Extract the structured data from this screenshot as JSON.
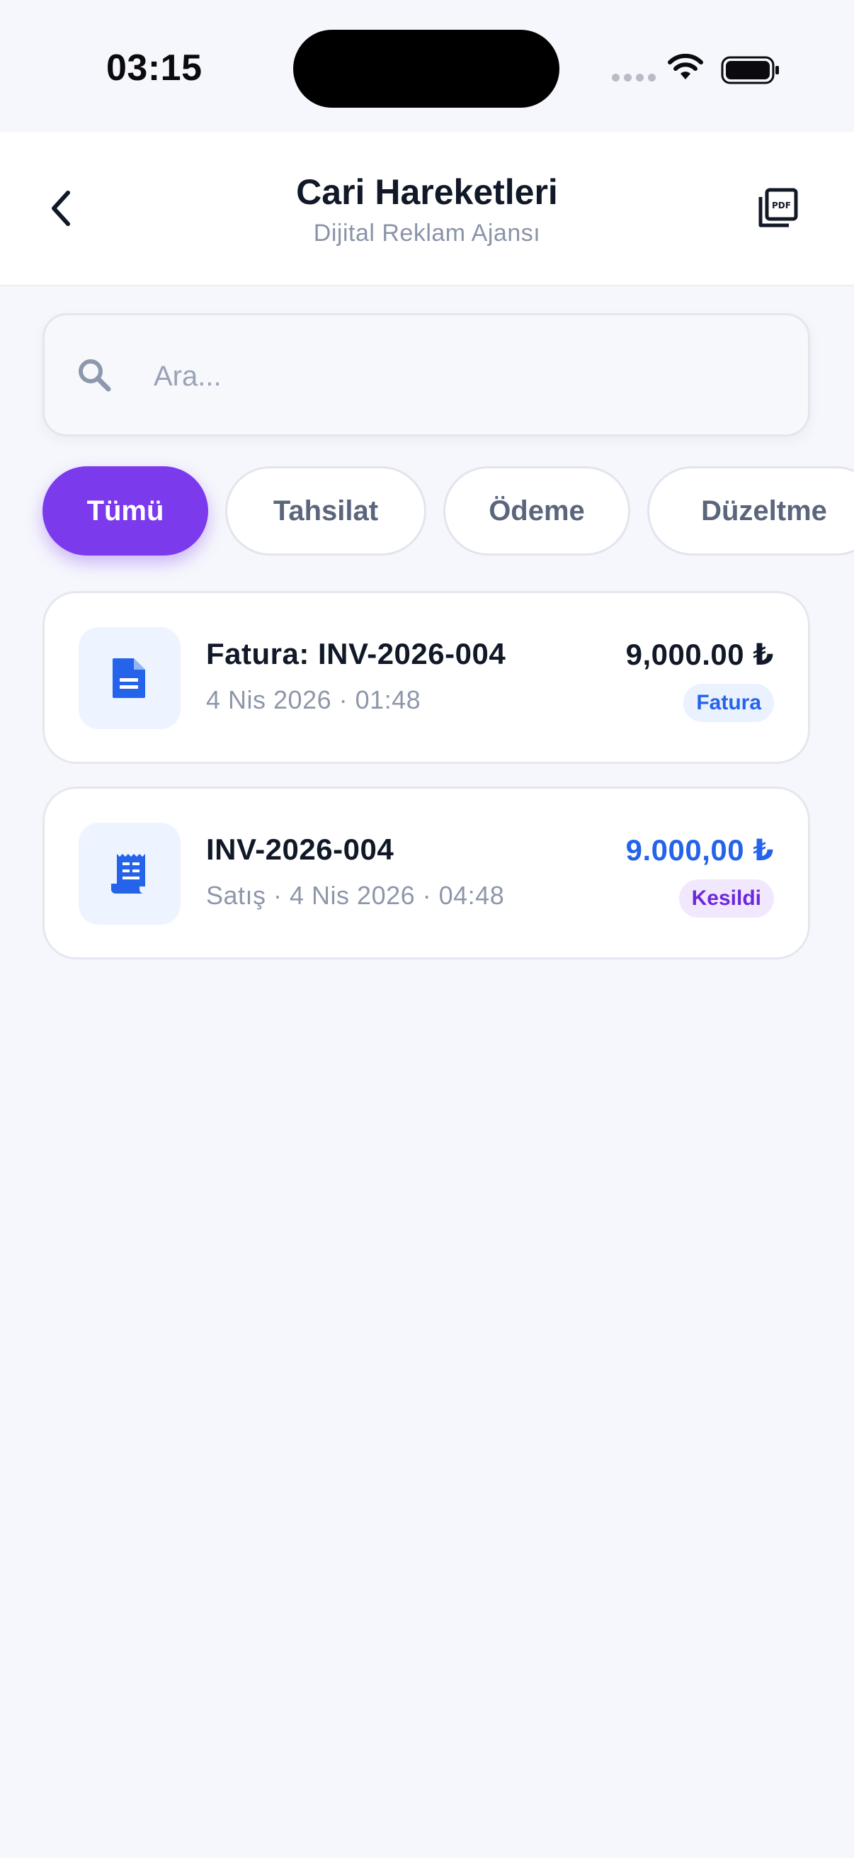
{
  "status_bar": {
    "time": "03:15"
  },
  "header": {
    "title": "Cari Hareketleri",
    "subtitle": "Dijital Reklam Ajansı",
    "back_icon": "chevron-left-icon",
    "pdf_icon": "pdf-export-icon"
  },
  "search": {
    "placeholder": "Ara...",
    "value": "",
    "icon": "search-icon"
  },
  "filters": [
    {
      "label": "Tümü",
      "active": true
    },
    {
      "label": "Tahsilat",
      "active": false
    },
    {
      "label": "Ödeme",
      "active": false
    },
    {
      "label": "Düzeltme",
      "active": false
    }
  ],
  "transactions": [
    {
      "title": "Fatura: INV-2026-004",
      "subtitle": "4 Nis 2026 · 01:48",
      "amount": "9,000.00 ₺",
      "amount_color": "#111827",
      "badge": "Fatura",
      "badge_color": "#2563eb",
      "badge_bg": "#eaf1ff",
      "icon": "document-icon"
    },
    {
      "title": "INV-2026-004",
      "subtitle": "Satış · 4 Nis 2026 · 04:48",
      "amount": "9.000,00 ₺",
      "amount_color": "#2563eb",
      "badge": "Kesildi",
      "badge_color": "#6d28d9",
      "badge_bg": "#f1e8fe",
      "icon": "receipt-icon"
    }
  ],
  "colors": {
    "accent": "#7c3aed",
    "blue": "#2563eb",
    "background": "#f6f7fc"
  }
}
